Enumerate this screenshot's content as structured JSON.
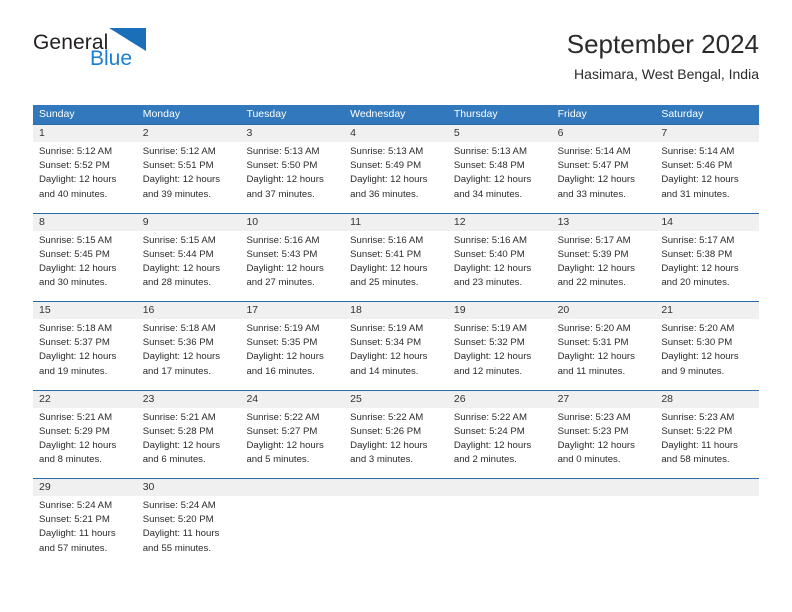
{
  "brand": {
    "line1": "General",
    "line2": "Blue",
    "triangle_color": "#1b7fd4",
    "icon": "triangle-logo-icon"
  },
  "header": {
    "title": "September 2024",
    "location": "Hasimara, West Bengal, India"
  },
  "theme": {
    "header_blue": "#3179bc",
    "divider_blue": "#2b6ca8",
    "day_band_gray": "#f0f0f0",
    "text": "#2b2b2b"
  },
  "labels": {
    "sunrise_prefix": "Sunrise:",
    "sunset_prefix": "Sunset:",
    "daylight_prefix": "Daylight:"
  },
  "weekday_headers": [
    "Sunday",
    "Monday",
    "Tuesday",
    "Wednesday",
    "Thursday",
    "Friday",
    "Saturday"
  ],
  "weeks": [
    [
      {
        "day": "1",
        "sunrise": "Sunrise: 5:12 AM",
        "sunset": "Sunset: 5:52 PM",
        "daylight_line1": "Daylight: 12 hours",
        "daylight_line2": "and 40 minutes."
      },
      {
        "day": "2",
        "sunrise": "Sunrise: 5:12 AM",
        "sunset": "Sunset: 5:51 PM",
        "daylight_line1": "Daylight: 12 hours",
        "daylight_line2": "and 39 minutes."
      },
      {
        "day": "3",
        "sunrise": "Sunrise: 5:13 AM",
        "sunset": "Sunset: 5:50 PM",
        "daylight_line1": "Daylight: 12 hours",
        "daylight_line2": "and 37 minutes."
      },
      {
        "day": "4",
        "sunrise": "Sunrise: 5:13 AM",
        "sunset": "Sunset: 5:49 PM",
        "daylight_line1": "Daylight: 12 hours",
        "daylight_line2": "and 36 minutes."
      },
      {
        "day": "5",
        "sunrise": "Sunrise: 5:13 AM",
        "sunset": "Sunset: 5:48 PM",
        "daylight_line1": "Daylight: 12 hours",
        "daylight_line2": "and 34 minutes."
      },
      {
        "day": "6",
        "sunrise": "Sunrise: 5:14 AM",
        "sunset": "Sunset: 5:47 PM",
        "daylight_line1": "Daylight: 12 hours",
        "daylight_line2": "and 33 minutes."
      },
      {
        "day": "7",
        "sunrise": "Sunrise: 5:14 AM",
        "sunset": "Sunset: 5:46 PM",
        "daylight_line1": "Daylight: 12 hours",
        "daylight_line2": "and 31 minutes."
      }
    ],
    [
      {
        "day": "8",
        "sunrise": "Sunrise: 5:15 AM",
        "sunset": "Sunset: 5:45 PM",
        "daylight_line1": "Daylight: 12 hours",
        "daylight_line2": "and 30 minutes."
      },
      {
        "day": "9",
        "sunrise": "Sunrise: 5:15 AM",
        "sunset": "Sunset: 5:44 PM",
        "daylight_line1": "Daylight: 12 hours",
        "daylight_line2": "and 28 minutes."
      },
      {
        "day": "10",
        "sunrise": "Sunrise: 5:16 AM",
        "sunset": "Sunset: 5:43 PM",
        "daylight_line1": "Daylight: 12 hours",
        "daylight_line2": "and 27 minutes."
      },
      {
        "day": "11",
        "sunrise": "Sunrise: 5:16 AM",
        "sunset": "Sunset: 5:41 PM",
        "daylight_line1": "Daylight: 12 hours",
        "daylight_line2": "and 25 minutes."
      },
      {
        "day": "12",
        "sunrise": "Sunrise: 5:16 AM",
        "sunset": "Sunset: 5:40 PM",
        "daylight_line1": "Daylight: 12 hours",
        "daylight_line2": "and 23 minutes."
      },
      {
        "day": "13",
        "sunrise": "Sunrise: 5:17 AM",
        "sunset": "Sunset: 5:39 PM",
        "daylight_line1": "Daylight: 12 hours",
        "daylight_line2": "and 22 minutes."
      },
      {
        "day": "14",
        "sunrise": "Sunrise: 5:17 AM",
        "sunset": "Sunset: 5:38 PM",
        "daylight_line1": "Daylight: 12 hours",
        "daylight_line2": "and 20 minutes."
      }
    ],
    [
      {
        "day": "15",
        "sunrise": "Sunrise: 5:18 AM",
        "sunset": "Sunset: 5:37 PM",
        "daylight_line1": "Daylight: 12 hours",
        "daylight_line2": "and 19 minutes."
      },
      {
        "day": "16",
        "sunrise": "Sunrise: 5:18 AM",
        "sunset": "Sunset: 5:36 PM",
        "daylight_line1": "Daylight: 12 hours",
        "daylight_line2": "and 17 minutes."
      },
      {
        "day": "17",
        "sunrise": "Sunrise: 5:19 AM",
        "sunset": "Sunset: 5:35 PM",
        "daylight_line1": "Daylight: 12 hours",
        "daylight_line2": "and 16 minutes."
      },
      {
        "day": "18",
        "sunrise": "Sunrise: 5:19 AM",
        "sunset": "Sunset: 5:34 PM",
        "daylight_line1": "Daylight: 12 hours",
        "daylight_line2": "and 14 minutes."
      },
      {
        "day": "19",
        "sunrise": "Sunrise: 5:19 AM",
        "sunset": "Sunset: 5:32 PM",
        "daylight_line1": "Daylight: 12 hours",
        "daylight_line2": "and 12 minutes."
      },
      {
        "day": "20",
        "sunrise": "Sunrise: 5:20 AM",
        "sunset": "Sunset: 5:31 PM",
        "daylight_line1": "Daylight: 12 hours",
        "daylight_line2": "and 11 minutes."
      },
      {
        "day": "21",
        "sunrise": "Sunrise: 5:20 AM",
        "sunset": "Sunset: 5:30 PM",
        "daylight_line1": "Daylight: 12 hours",
        "daylight_line2": "and 9 minutes."
      }
    ],
    [
      {
        "day": "22",
        "sunrise": "Sunrise: 5:21 AM",
        "sunset": "Sunset: 5:29 PM",
        "daylight_line1": "Daylight: 12 hours",
        "daylight_line2": "and 8 minutes."
      },
      {
        "day": "23",
        "sunrise": "Sunrise: 5:21 AM",
        "sunset": "Sunset: 5:28 PM",
        "daylight_line1": "Daylight: 12 hours",
        "daylight_line2": "and 6 minutes."
      },
      {
        "day": "24",
        "sunrise": "Sunrise: 5:22 AM",
        "sunset": "Sunset: 5:27 PM",
        "daylight_line1": "Daylight: 12 hours",
        "daylight_line2": "and 5 minutes."
      },
      {
        "day": "25",
        "sunrise": "Sunrise: 5:22 AM",
        "sunset": "Sunset: 5:26 PM",
        "daylight_line1": "Daylight: 12 hours",
        "daylight_line2": "and 3 minutes."
      },
      {
        "day": "26",
        "sunrise": "Sunrise: 5:22 AM",
        "sunset": "Sunset: 5:24 PM",
        "daylight_line1": "Daylight: 12 hours",
        "daylight_line2": "and 2 minutes."
      },
      {
        "day": "27",
        "sunrise": "Sunrise: 5:23 AM",
        "sunset": "Sunset: 5:23 PM",
        "daylight_line1": "Daylight: 12 hours",
        "daylight_line2": "and 0 minutes."
      },
      {
        "day": "28",
        "sunrise": "Sunrise: 5:23 AM",
        "sunset": "Sunset: 5:22 PM",
        "daylight_line1": "Daylight: 11 hours",
        "daylight_line2": "and 58 minutes."
      }
    ],
    [
      {
        "day": "29",
        "sunrise": "Sunrise: 5:24 AM",
        "sunset": "Sunset: 5:21 PM",
        "daylight_line1": "Daylight: 11 hours",
        "daylight_line2": "and 57 minutes."
      },
      {
        "day": "30",
        "sunrise": "Sunrise: 5:24 AM",
        "sunset": "Sunset: 5:20 PM",
        "daylight_line1": "Daylight: 11 hours",
        "daylight_line2": "and 55 minutes."
      },
      {
        "day": "",
        "sunrise": "",
        "sunset": "",
        "daylight_line1": "",
        "daylight_line2": ""
      },
      {
        "day": "",
        "sunrise": "",
        "sunset": "",
        "daylight_line1": "",
        "daylight_line2": ""
      },
      {
        "day": "",
        "sunrise": "",
        "sunset": "",
        "daylight_line1": "",
        "daylight_line2": ""
      },
      {
        "day": "",
        "sunrise": "",
        "sunset": "",
        "daylight_line1": "",
        "daylight_line2": ""
      },
      {
        "day": "",
        "sunrise": "",
        "sunset": "",
        "daylight_line1": "",
        "daylight_line2": ""
      }
    ]
  ]
}
